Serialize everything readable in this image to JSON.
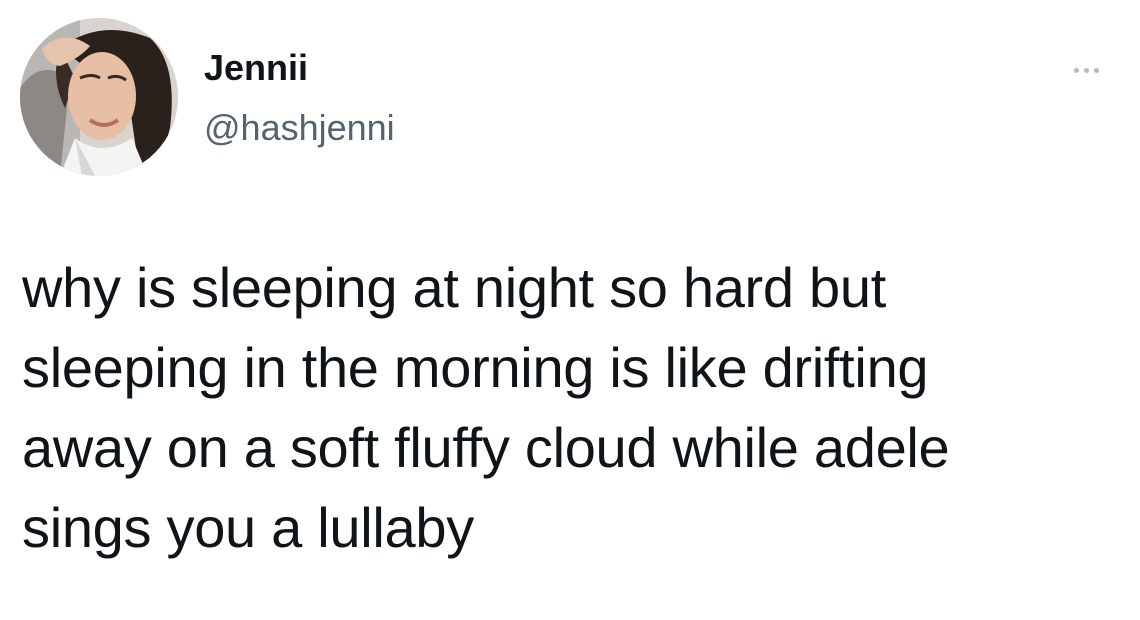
{
  "tweet": {
    "author": {
      "display_name": "Jennii",
      "handle": "@hashjenni",
      "avatar_icon": "profile-photo"
    },
    "menu_icon": "more-options-icon",
    "text_lines": [
      "why is sleeping at night so hard but",
      "sleeping in the morning is like drifting",
      "away on a soft fluffy cloud while adele",
      "sings you a lullaby"
    ]
  },
  "colors": {
    "background": "#ffffff",
    "primary_text": "#0f1419",
    "secondary_text": "#536471",
    "menu_dots": "#b4bcc3"
  }
}
